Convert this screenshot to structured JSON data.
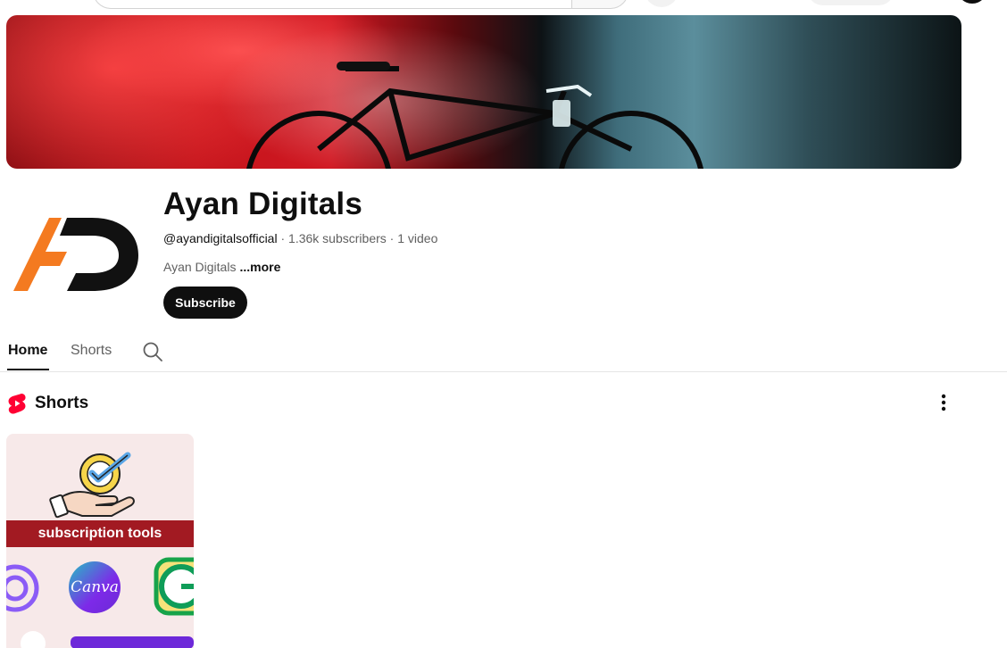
{
  "channel": {
    "name": "Ayan Digitals",
    "handle": "@ayandigitalsofficial",
    "separator": " · ",
    "subscribers": "1.36k subscribers",
    "videos": "1 video",
    "description": "Ayan Digitals",
    "more_label": "...more",
    "subscribe_label": "Subscribe"
  },
  "tabs": [
    {
      "label": "Home",
      "selected": true
    },
    {
      "label": "Shorts",
      "selected": false
    }
  ],
  "icons": {
    "tab_search": "search-icon",
    "shorts_logo": "shorts-icon",
    "section_menu": "more-vert-icon"
  },
  "shorts_section": {
    "title": "Shorts",
    "items": [
      {
        "thumbnail_text": "subscription tools",
        "logo_text": "Canva"
      }
    ]
  },
  "colors": {
    "accent_red": "#ff0033",
    "button_dark": "#0f0f0f",
    "thumb_band": "#a21a22",
    "logo_orange": "#f47a20"
  }
}
